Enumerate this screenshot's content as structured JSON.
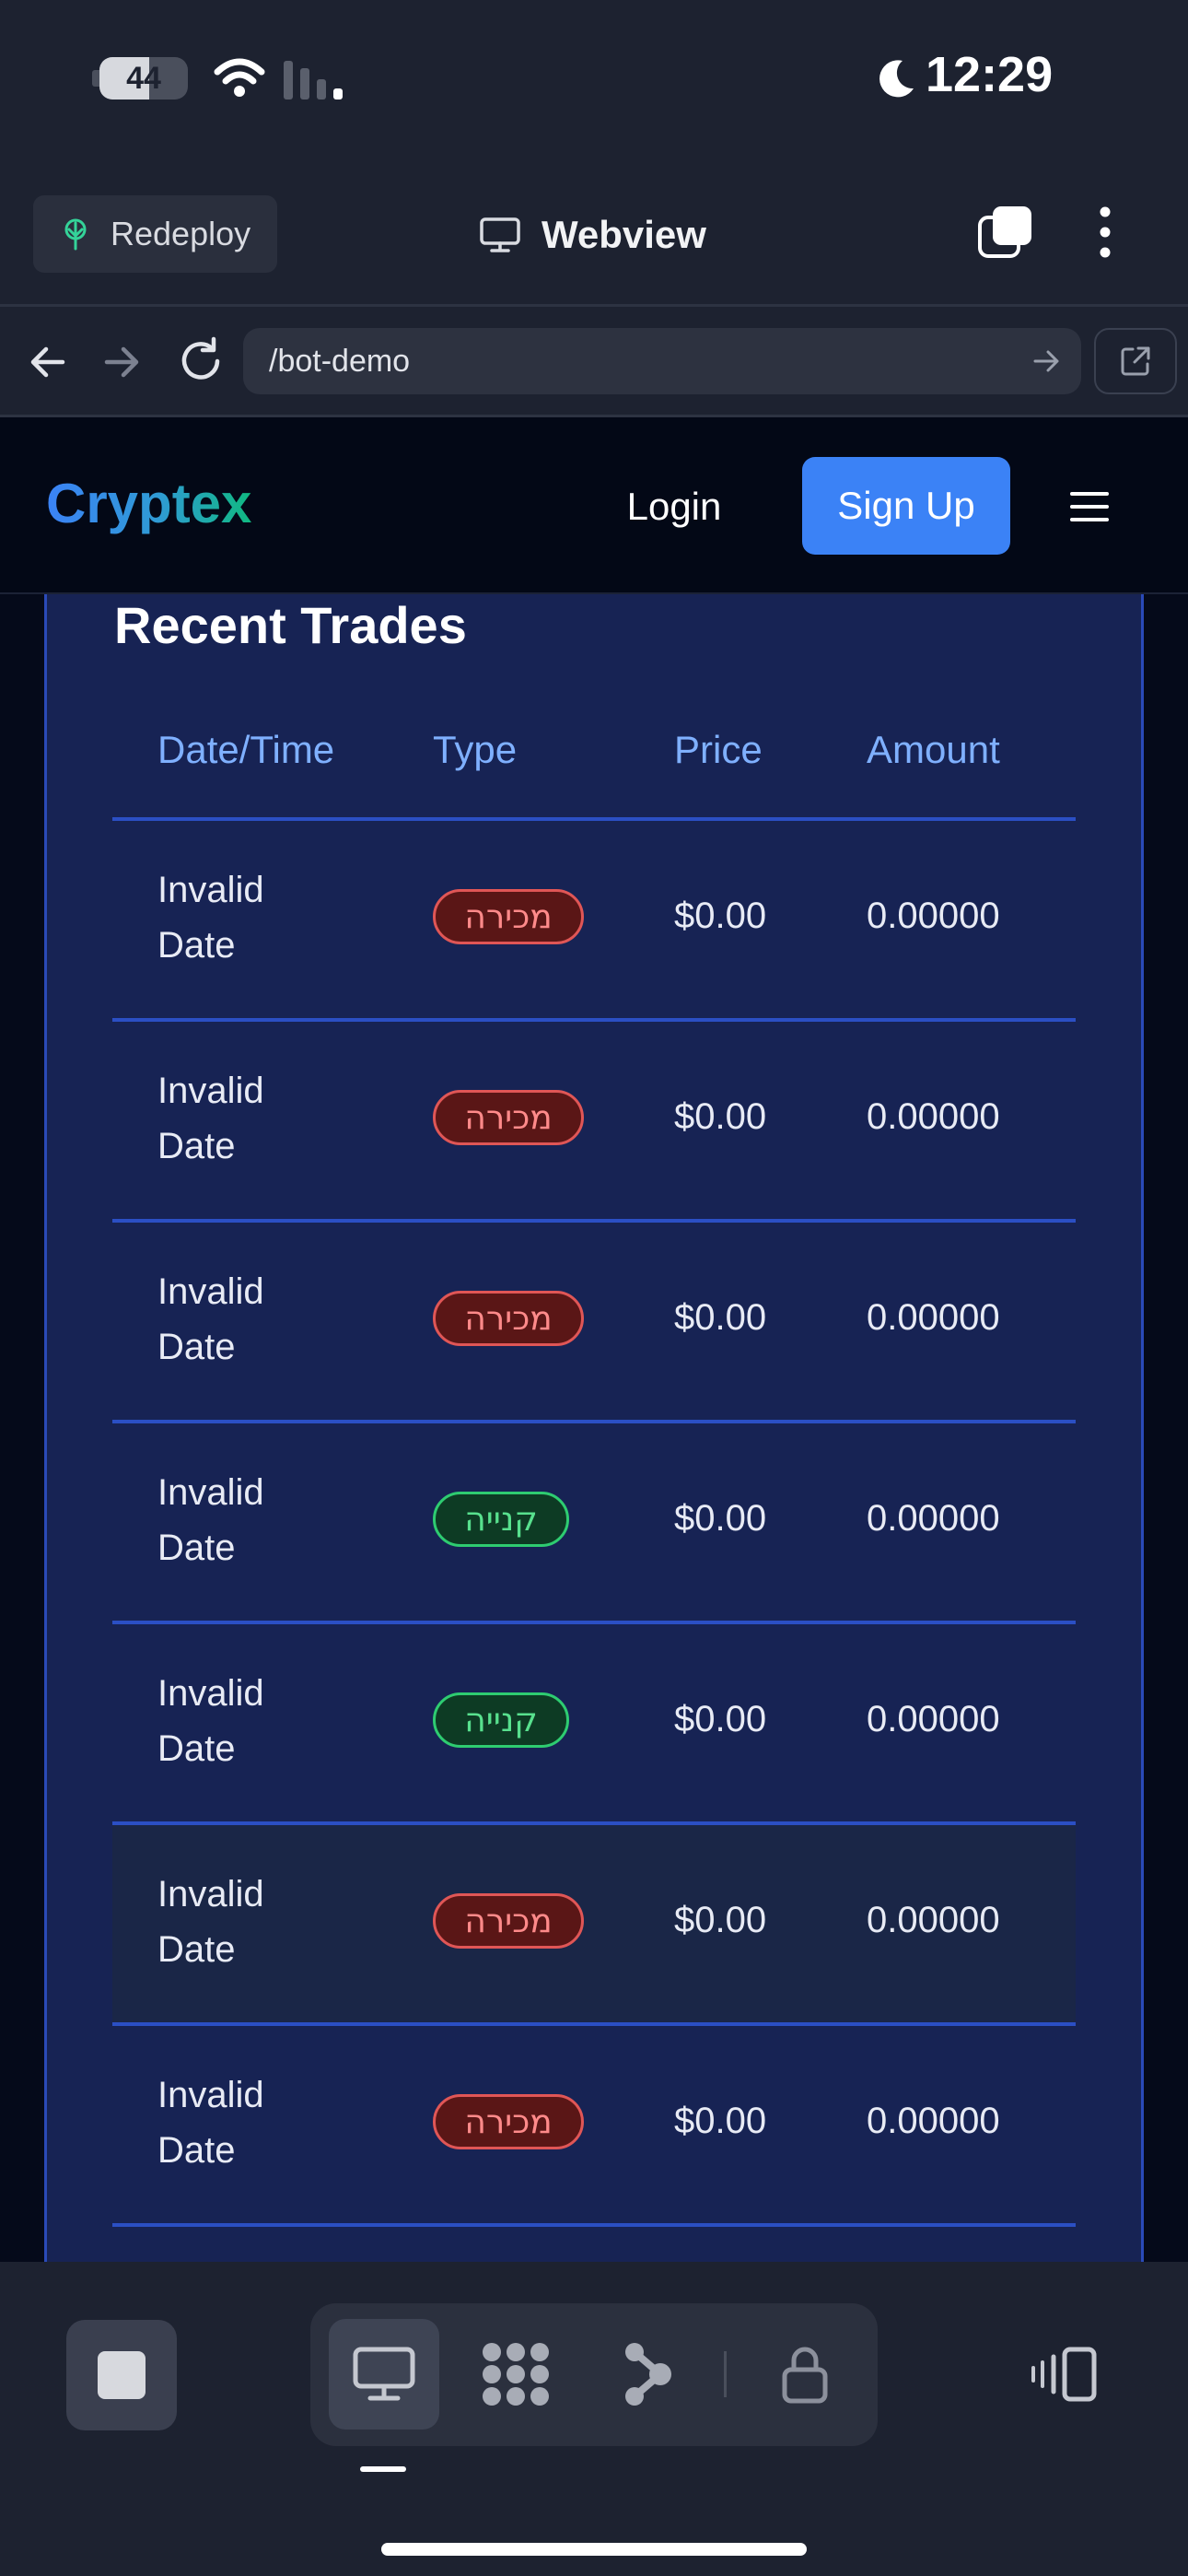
{
  "status_bar": {
    "battery_level": "44",
    "time": "12:29",
    "icons": [
      "battery-icon",
      "wifi-icon",
      "cellular-signal-icon",
      "moon-icon"
    ]
  },
  "browser": {
    "redeploy_label": "Redeploy",
    "title": "Webview",
    "url": "/bot-demo",
    "icons": [
      "redeploy-icon",
      "monitor-icon",
      "tabs-icon",
      "more-vertical-icon",
      "back-arrow-icon",
      "forward-arrow-icon",
      "reload-icon",
      "url-go-arrow-icon",
      "external-link-icon"
    ]
  },
  "site": {
    "logo": "Cryptex",
    "login_label": "Login",
    "signup_label": "Sign Up",
    "accent_color": "#3b82f6"
  },
  "trades": {
    "title": "Recent Trades",
    "columns": [
      "Date/Time",
      "Type",
      "Price",
      "Amount"
    ],
    "rows": [
      {
        "date_line1": "Invalid",
        "date_line2": "Date",
        "type": "מכירה",
        "side": "sell",
        "price": "$0.00",
        "amount": "0.00000"
      },
      {
        "date_line1": "Invalid",
        "date_line2": "Date",
        "type": "מכירה",
        "side": "sell",
        "price": "$0.00",
        "amount": "0.00000"
      },
      {
        "date_line1": "Invalid",
        "date_line2": "Date",
        "type": "מכירה",
        "side": "sell",
        "price": "$0.00",
        "amount": "0.00000"
      },
      {
        "date_line1": "Invalid",
        "date_line2": "Date",
        "type": "קנייה",
        "side": "buy",
        "price": "$0.00",
        "amount": "0.00000"
      },
      {
        "date_line1": "Invalid",
        "date_line2": "Date",
        "type": "קנייה",
        "side": "buy",
        "price": "$0.00",
        "amount": "0.00000"
      },
      {
        "date_line1": "Invalid",
        "date_line2": "Date",
        "type": "מכירה",
        "side": "sell",
        "price": "$0.00",
        "amount": "0.00000"
      },
      {
        "date_line1": "Invalid",
        "date_line2": "Date",
        "type": "מכירה",
        "side": "sell",
        "price": "$0.00",
        "amount": "0.00000"
      }
    ],
    "sell_color": "#e05656",
    "buy_color": "#2ecc71"
  },
  "toolbar": {
    "icons": [
      "stop-icon",
      "desktop-icon",
      "apps-icon",
      "flow-icon",
      "lock-icon",
      "rotate-device-icon"
    ]
  }
}
